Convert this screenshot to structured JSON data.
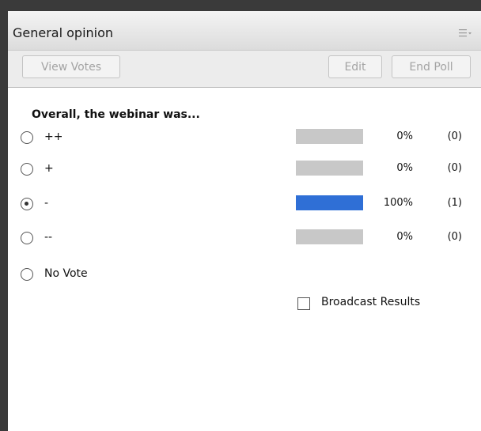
{
  "panel": {
    "title": "General opinion",
    "menu_icon": "hamburger-menu-icon"
  },
  "toolbar": {
    "view_votes_label": "View Votes",
    "edit_label": "Edit",
    "end_poll_label": "End Poll"
  },
  "poll": {
    "question": "Overall, the webinar was...",
    "options": [
      {
        "label": "++",
        "percent_label": "0%",
        "count_label": "(0)",
        "selected": false,
        "share": 0
      },
      {
        "label": "+",
        "percent_label": "0%",
        "count_label": "(0)",
        "selected": false,
        "share": 0
      },
      {
        "label": "-",
        "percent_label": "100%",
        "count_label": "(1)",
        "selected": true,
        "share": 1
      },
      {
        "label": "--",
        "percent_label": "0%",
        "count_label": "(0)",
        "selected": false,
        "share": 0
      },
      {
        "label": "No Vote",
        "selected": false
      }
    ],
    "bar_color": "#2f6fd6",
    "bar_bg_color": "#c8c8c8"
  },
  "broadcast": {
    "label": "Broadcast Results",
    "checked": false
  }
}
